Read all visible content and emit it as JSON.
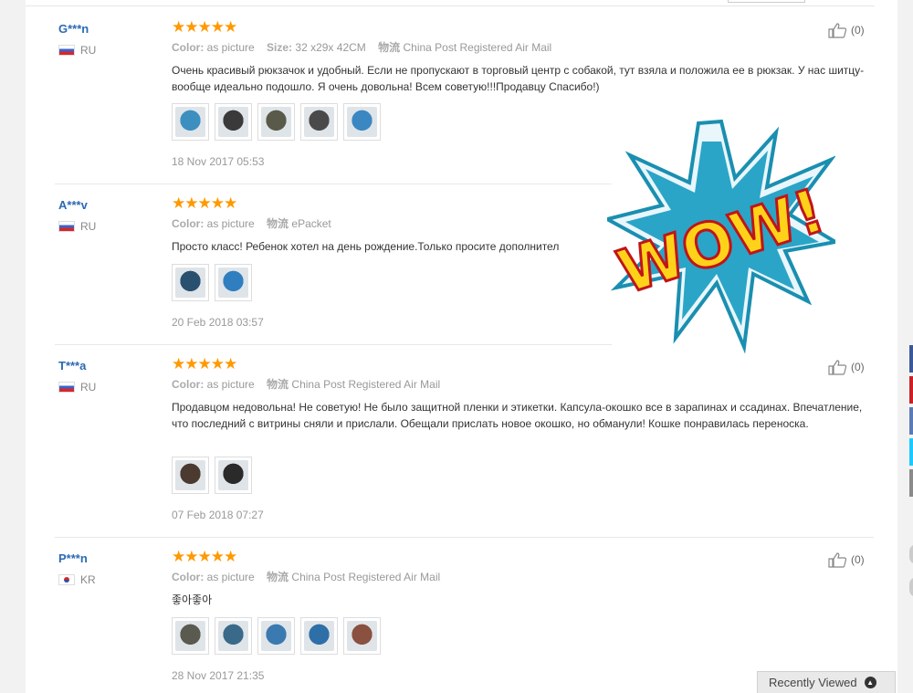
{
  "labels": {
    "color": "Color:",
    "size": "Size:",
    "shipping": "物流",
    "stars": "★★★★★"
  },
  "reviews": [
    {
      "user": "G***n",
      "country": "RU",
      "color": "as picture",
      "size": "32 x29x 42CM",
      "shipping": "China Post Registered Air Mail",
      "text": "Очень красивый рюкзачок и удобный. Если не пропускают в торговый центр с собакой, тут взяла и положила ее в рюкзак. У нас шитцу-вообще идеально подошло. Я очень довольна! Всем советую!!!Продавцу Спасибо!)",
      "date": "18 Nov 2017 05:53",
      "helpful": "(0)",
      "thumb_colors": [
        "#3d8fc0",
        "#3a3a3a",
        "#5a5a4a",
        "#4a4a4a",
        "#3b87c2"
      ]
    },
    {
      "user": "A***v",
      "country": "RU",
      "color": "as picture",
      "shipping": "ePacket",
      "text": "Просто класс! Ребенок хотел на день рождение.Только просите дополнител",
      "date": "20 Feb 2018 03:57",
      "thumb_colors": [
        "#2a5070",
        "#2f7fc0"
      ]
    },
    {
      "user": "T***a",
      "country": "RU",
      "color": "as picture",
      "shipping": "China Post Registered Air Mail",
      "text": "Продавцом недовольна! Не советую! Не было защитной пленки и этикетки. Капсула-окошко все в зарапинах и ссадинах. Впечатление, что последний с витрины сняли и прислали. Обещали прислать новое окошко, но обманули! Кошке понравилась переноска.",
      "date": "07 Feb 2018 07:27",
      "helpful": "(0)",
      "thumb_colors": [
        "#4a3a30",
        "#2a2a2a"
      ]
    },
    {
      "user": "P***n",
      "country": "KR",
      "color": "as picture",
      "shipping": "China Post Registered Air Mail",
      "text": "좋아좋아",
      "date": "28 Nov 2017 21:35",
      "helpful": "(0)",
      "thumb_colors": [
        "#5a5a50",
        "#3a6a8a",
        "#3a7ab0",
        "#2f6fa8",
        "#8a5040"
      ]
    }
  ],
  "sticker": {
    "text": "WOW!",
    "colors": [
      "#1a8fb0",
      "#ff3a1a",
      "#ffd21a"
    ]
  },
  "recently_viewed": {
    "label": "Recently Viewed",
    "icon": "chevron-up-icon"
  }
}
